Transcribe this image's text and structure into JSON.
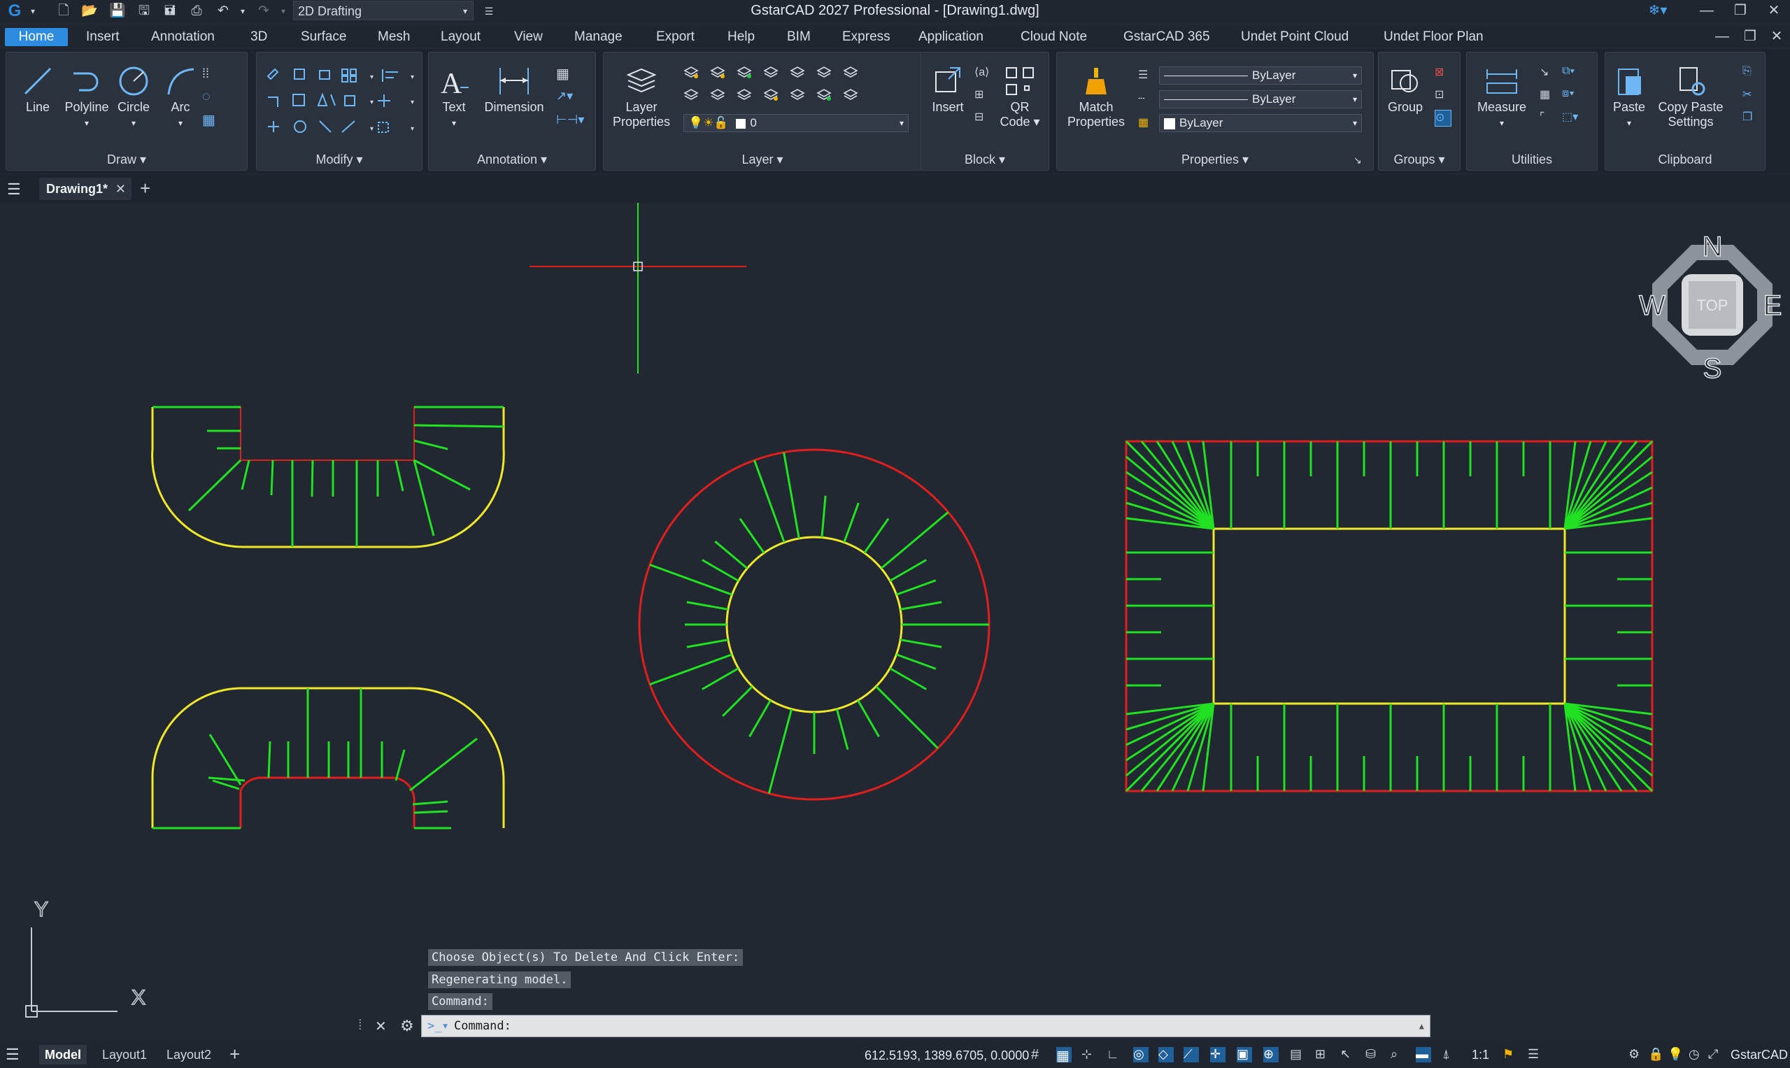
{
  "app": {
    "title": "GstarCAD 2027 Professional - [Drawing1.dwg]"
  },
  "quick_access": {
    "workspace": "2D Drafting"
  },
  "menu": [
    "Home",
    "Insert",
    "Annotation",
    "3D",
    "Surface",
    "Mesh",
    "Layout",
    "View",
    "Manage",
    "Export",
    "Help",
    "BIM",
    "Express",
    "Application",
    "Cloud Note",
    "GstarCAD 365",
    "Undet Point Cloud",
    "Undet Floor Plan"
  ],
  "ribbon": {
    "draw": {
      "label": "Draw ▾",
      "line": "Line",
      "polyline": "Polyline",
      "circle": "Circle",
      "arc": "Arc"
    },
    "modify": {
      "label": "Modify ▾"
    },
    "annotation": {
      "label": "Annotation ▾",
      "text": "Text",
      "dimension": "Dimension"
    },
    "layer": {
      "label": "Layer ▾",
      "layer_properties_1": "Layer",
      "layer_properties_2": "Properties",
      "current_layer": "0"
    },
    "block": {
      "label": "Block ▾",
      "insert": "Insert",
      "qr_1": "QR",
      "qr_2": "Code ▾"
    },
    "properties": {
      "label": "Properties ▾",
      "match_1": "Match",
      "match_2": "Properties",
      "linetype": "ByLayer",
      "lineweight": "ByLayer",
      "color": "ByLayer"
    },
    "groups": {
      "label": "Groups ▾",
      "group": "Group"
    },
    "utilities": {
      "label": "Utilities",
      "measure": "Measure"
    },
    "clipboard": {
      "label": "Clipboard",
      "paste": "Paste",
      "copy_paste_1": "Copy Paste",
      "copy_paste_2": "Settings"
    }
  },
  "doc_tab": {
    "name": "Drawing1*"
  },
  "viewcube": {
    "n": "N",
    "s": "S",
    "e": "E",
    "w": "W",
    "face": "TOP"
  },
  "ucs": {
    "x": "X",
    "y": "Y"
  },
  "command": {
    "history": [
      "Choose Object(s) To Delete And Click Enter:",
      "Regenerating model.",
      "Command:"
    ],
    "prompt": "Command:"
  },
  "status": {
    "tabs": [
      "Model",
      "Layout1",
      "Layout2"
    ],
    "coordinates": "612.5193, 1389.6705, 0.0000",
    "scale": "1:1",
    "brand": "GstarCAD"
  },
  "colors": {
    "accent": "#2e8ce0",
    "red": "#e01e1e",
    "yellow": "#f0e828",
    "green": "#22e022",
    "canvas": "#212832"
  }
}
